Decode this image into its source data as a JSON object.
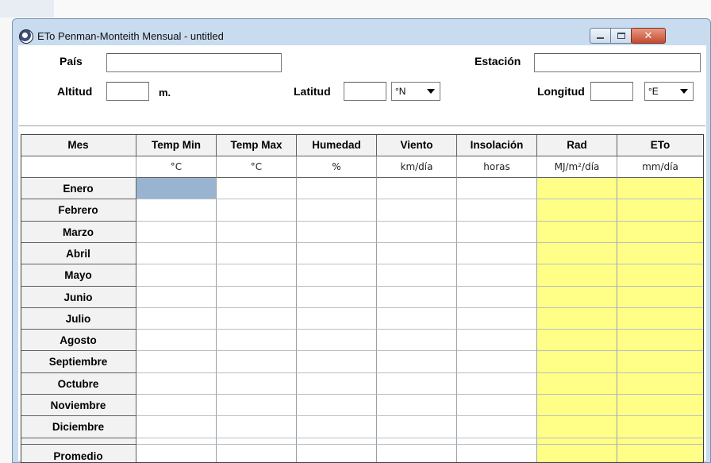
{
  "window": {
    "title": "ETo Penman-Monteith Mensual - untitled",
    "colors": {
      "frame": "#c9dbee",
      "close_button": "#c44a2f",
      "highlight_column": "#ffff88",
      "selected_cell": "#99b4d1"
    }
  },
  "form": {
    "pais_label": "País",
    "pais_value": "",
    "estacion_label": "Estación",
    "estacion_value": "",
    "altitud_label": "Altitud",
    "altitud_value": "",
    "altitud_unit": "m.",
    "latitud_label": "Latitud",
    "latitud_value": "",
    "latitud_dir": "°N",
    "longitud_label": "Longitud",
    "longitud_value": "",
    "longitud_dir": "°E"
  },
  "table": {
    "headers": [
      "Mes",
      "Temp Min",
      "Temp Max",
      "Humedad",
      "Viento",
      "Insolación",
      "Rad",
      "ETo"
    ],
    "units": [
      "",
      "°C",
      "°C",
      "%",
      "km/día",
      "horas",
      "MJ/m²/día",
      "mm/día"
    ],
    "months": [
      "Enero",
      "Febrero",
      "Marzo",
      "Abril",
      "Mayo",
      "Junio",
      "Julio",
      "Agosto",
      "Septiembre",
      "Octubre",
      "Noviembre",
      "Diciembre"
    ],
    "promedio_label": "Promedio",
    "highlighted_columns": [
      "Rad",
      "ETo"
    ]
  },
  "icons": {
    "app": "app-globe-icon",
    "minimize": "minimize-icon",
    "maximize": "maximize-icon",
    "close": "close-icon"
  }
}
